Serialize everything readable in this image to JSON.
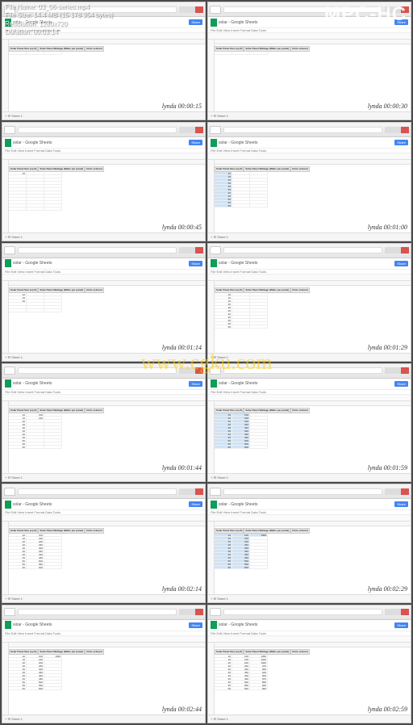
{
  "player": {
    "name_label": "File Name:",
    "name": "03_06-series.mp4",
    "size_label": "File Size:",
    "size": "14.4 MB (15 178 354 bytes)",
    "res_label": "Resolution:",
    "res": "1280x720",
    "dur_label": "Duration:",
    "dur": "00:03:14",
    "brand": "MPC-HC"
  },
  "watermark": "www.cgku.com",
  "sheet": {
    "share": "Share",
    "footer": "Sheet 1",
    "doc_title": "solar - Google Sheets",
    "headers": [
      "Solar Panel Size\n(sq ft)",
      "Solar Panel Wattage\n(Watts per panel)",
      "Units\nordered"
    ],
    "menu": "File  Edit  View  Insert  Format  Data  Tools"
  },
  "thumbs": [
    {
      "ts": "00:00:15",
      "rows": [
        [
          "",
          "",
          ""
        ]
      ],
      "filled": false
    },
    {
      "ts": "00:00:30",
      "rows": [
        [
          "",
          "",
          ""
        ]
      ],
      "filled": false
    },
    {
      "ts": "00:00:45",
      "rows": [
        [
          "10",
          "",
          ""
        ],
        [
          "",
          "",
          ""
        ],
        [
          "",
          "",
          ""
        ],
        [
          "",
          "",
          ""
        ],
        [
          "",
          "",
          ""
        ],
        [
          "",
          "",
          ""
        ],
        [
          "",
          "",
          ""
        ],
        [
          "",
          "",
          ""
        ],
        [
          "",
          "",
          ""
        ],
        [
          "",
          "",
          ""
        ],
        [
          "",
          "",
          ""
        ],
        [
          "",
          "",
          ""
        ]
      ],
      "filled": false
    },
    {
      "ts": "00:01:00",
      "rows": [
        [
          "10",
          "",
          ""
        ],
        [
          "15",
          "",
          ""
        ],
        [
          "20",
          "",
          ""
        ],
        [
          "25",
          "",
          ""
        ],
        [
          "30",
          "",
          ""
        ],
        [
          "35",
          "",
          ""
        ],
        [
          "40",
          "",
          ""
        ],
        [
          "45",
          "",
          ""
        ],
        [
          "50",
          "",
          ""
        ],
        [
          "55",
          "",
          ""
        ],
        [
          "60",
          "",
          ""
        ]
      ],
      "filled": true
    },
    {
      "ts": "00:01:14",
      "rows": [
        [
          "10",
          "",
          ""
        ],
        [
          "15",
          "",
          ""
        ],
        [
          "20",
          "",
          ""
        ],
        [
          "",
          "",
          ""
        ],
        [
          "",
          "",
          ""
        ],
        [
          "",
          "",
          ""
        ]
      ],
      "filled": false
    },
    {
      "ts": "00:01:29",
      "rows": [
        [
          "10",
          "",
          ""
        ],
        [
          "15",
          "",
          ""
        ],
        [
          "20",
          "",
          ""
        ],
        [
          "25",
          "",
          ""
        ],
        [
          "30",
          "",
          ""
        ],
        [
          "35",
          "",
          ""
        ],
        [
          "40",
          "",
          ""
        ],
        [
          "45",
          "",
          ""
        ],
        [
          "50",
          "",
          ""
        ],
        [
          "55",
          "",
          ""
        ],
        [
          "60",
          "",
          ""
        ]
      ],
      "filled": false
    },
    {
      "ts": "00:01:44",
      "rows": [
        [
          "10",
          "100",
          ""
        ],
        [
          "15",
          "150",
          ""
        ],
        [
          "20",
          "",
          ""
        ],
        [
          "25",
          "",
          ""
        ],
        [
          "30",
          "",
          ""
        ],
        [
          "35",
          "",
          ""
        ],
        [
          "40",
          "",
          ""
        ],
        [
          "45",
          "",
          ""
        ],
        [
          "50",
          "",
          ""
        ],
        [
          "55",
          "",
          ""
        ],
        [
          "60",
          "",
          ""
        ]
      ],
      "filled": false
    },
    {
      "ts": "00:01:59",
      "rows": [
        [
          "10",
          "100",
          ""
        ],
        [
          "15",
          "150",
          ""
        ],
        [
          "20",
          "200",
          ""
        ],
        [
          "25",
          "250",
          ""
        ],
        [
          "30",
          "300",
          ""
        ],
        [
          "35",
          "350",
          ""
        ],
        [
          "40",
          "400",
          ""
        ],
        [
          "45",
          "450",
          ""
        ],
        [
          "50",
          "500",
          ""
        ],
        [
          "55",
          "550",
          ""
        ],
        [
          "60",
          "600",
          ""
        ]
      ],
      "filled": true
    },
    {
      "ts": "00:02:14",
      "rows": [
        [
          "10",
          "100",
          ""
        ],
        [
          "15",
          "150",
          ""
        ],
        [
          "20",
          "200",
          ""
        ],
        [
          "25",
          "250",
          ""
        ],
        [
          "30",
          "300",
          ""
        ],
        [
          "35",
          "350",
          ""
        ],
        [
          "40",
          "400",
          ""
        ],
        [
          "45",
          "450",
          ""
        ],
        [
          "50",
          "500",
          ""
        ],
        [
          "55",
          "550",
          ""
        ],
        [
          "60",
          "600",
          ""
        ]
      ],
      "filled": false
    },
    {
      "ts": "00:02:29",
      "rows": [
        [
          "10",
          "100",
          "1050"
        ],
        [
          "15",
          "150",
          ""
        ],
        [
          "20",
          "200",
          ""
        ],
        [
          "25",
          "250",
          ""
        ],
        [
          "30",
          "300",
          ""
        ],
        [
          "35",
          "350",
          ""
        ],
        [
          "40",
          "400",
          ""
        ],
        [
          "45",
          "450",
          ""
        ],
        [
          "50",
          "500",
          ""
        ],
        [
          "55",
          "550",
          ""
        ],
        [
          "60",
          "600",
          ""
        ]
      ],
      "filled": true
    },
    {
      "ts": "00:02:44",
      "rows": [
        [
          "10",
          "100",
          "1050"
        ],
        [
          "15",
          "150",
          ""
        ],
        [
          "20",
          "200",
          ""
        ],
        [
          "25",
          "250",
          ""
        ],
        [
          "30",
          "300",
          ""
        ],
        [
          "35",
          "350",
          ""
        ],
        [
          "40",
          "400",
          ""
        ],
        [
          "45",
          "450",
          ""
        ],
        [
          "50",
          "500",
          ""
        ],
        [
          "55",
          "550",
          ""
        ],
        [
          "60",
          "600",
          ""
        ]
      ],
      "filled": false
    },
    {
      "ts": "00:02:59",
      "rows": [
        [
          "10",
          "100",
          "1050"
        ],
        [
          "15",
          "150",
          "1025"
        ],
        [
          "20",
          "200",
          "1000"
        ],
        [
          "25",
          "250",
          "975"
        ],
        [
          "30",
          "300",
          "950"
        ],
        [
          "35",
          "350",
          "925"
        ],
        [
          "40",
          "400",
          "900"
        ],
        [
          "45",
          "450",
          "875"
        ],
        [
          "50",
          "500",
          "850"
        ],
        [
          "55",
          "550",
          "825"
        ],
        [
          "60",
          "600",
          "800"
        ]
      ],
      "filled": false
    }
  ]
}
